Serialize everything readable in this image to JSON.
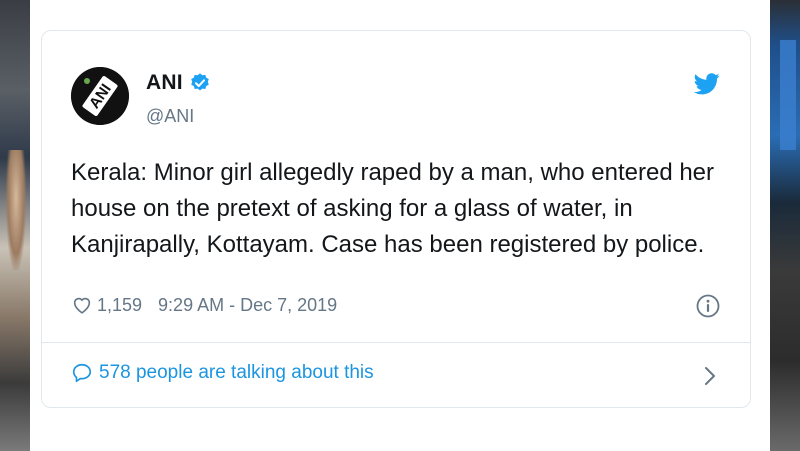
{
  "tweet": {
    "display_name": "ANI",
    "handle": "@ANI",
    "avatar_text": "ANI",
    "text": "Kerala: Minor girl allegedly raped by a man, who entered her house on the pretext of asking for a glass of water, in Kanjirapally, Kottayam. Case has been registered by police.",
    "likes": "1,159",
    "timestamp": "9:29 AM - Dec 7, 2019",
    "talking": "578 people are talking about this"
  },
  "icons": {
    "verified": "verified-badge-icon",
    "bird": "twitter-bird-icon",
    "heart": "heart-icon",
    "info": "info-icon",
    "bubble": "speech-bubble-icon",
    "chevron": "chevron-right-icon"
  },
  "colors": {
    "accent": "#1da1f2",
    "link": "#1b95e0",
    "text": "#14171a",
    "muted": "#657786",
    "border": "#e1e8ed"
  }
}
